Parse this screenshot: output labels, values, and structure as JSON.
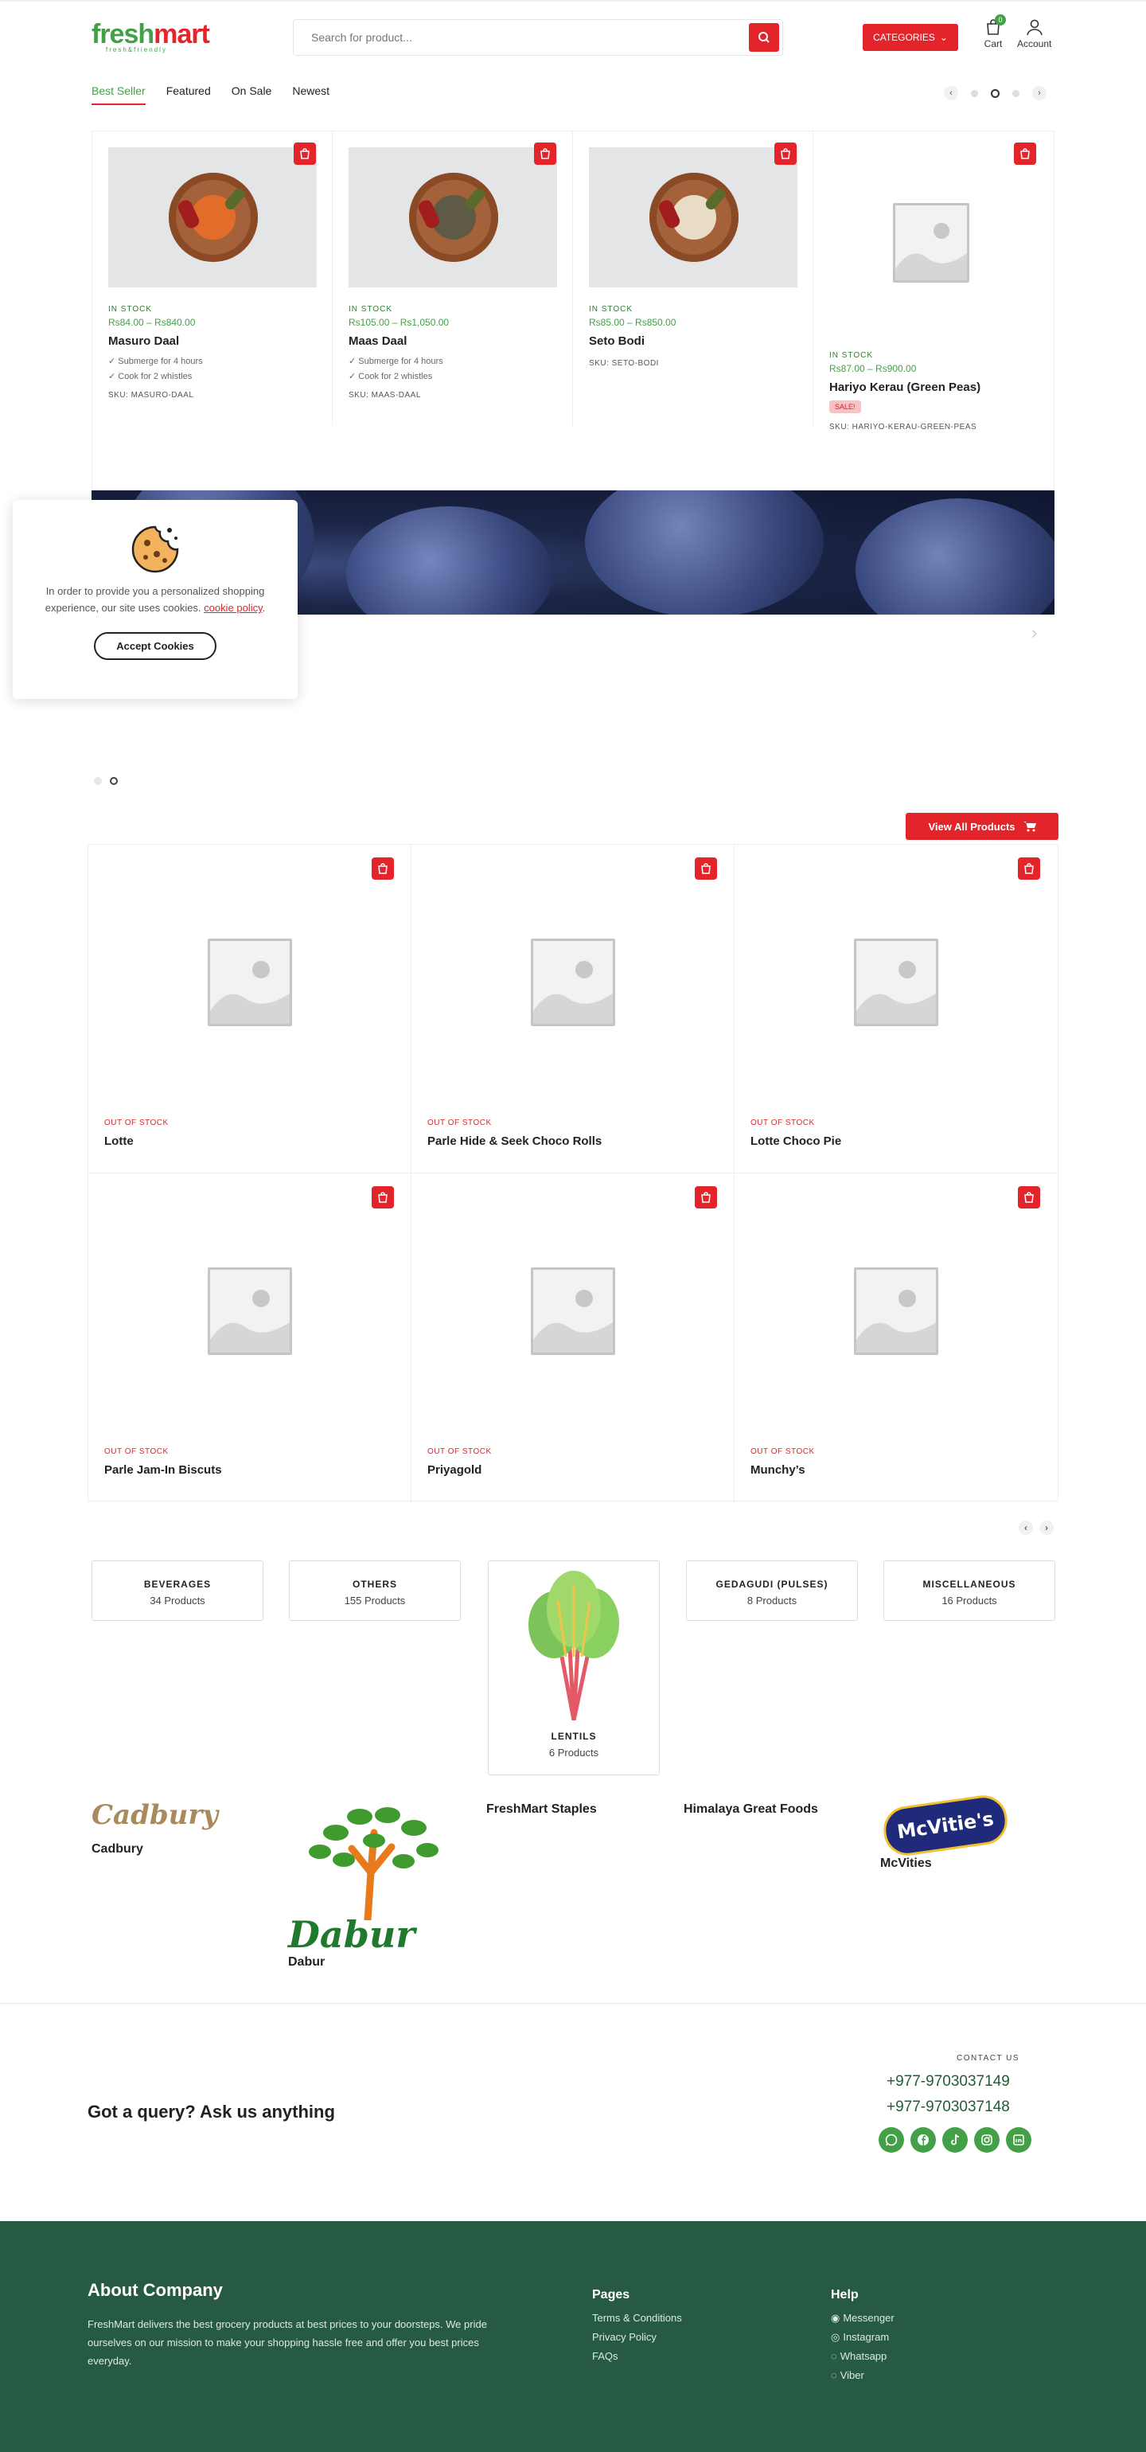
{
  "header": {
    "logo_main_g": "fresh",
    "logo_main_r": "mart",
    "logo_tag": "fresh&friendly",
    "search_placeholder": "Search for product...",
    "categories_label": "CATEGORIES",
    "cart_label": "Cart",
    "cart_count": "0",
    "account_label": "Account"
  },
  "tabs": [
    {
      "label": "Best Seller",
      "active": true
    },
    {
      "label": "Featured"
    },
    {
      "label": "On Sale"
    },
    {
      "label": "Newest"
    }
  ],
  "products": [
    {
      "stock": "IN STOCK",
      "price": "Rs84.00 – Rs840.00",
      "name": "Masuro Daal",
      "features": [
        "✓ Submerge for 4 hours",
        "✓ Cook for 2 whistles"
      ],
      "sku": "SKU: MASURO-DAAL"
    },
    {
      "stock": "IN STOCK",
      "price": "Rs105.00 – Rs1,050.00",
      "name": "Maas Daal",
      "features": [
        "✓ Submerge for 4 hours",
        "✓ Cook for 2 whistles"
      ],
      "sku": "SKU: MAAS-DAAL"
    },
    {
      "stock": "IN STOCK",
      "price": "Rs85.00 – Rs850.00",
      "name": "Seto Bodi",
      "sku": "SKU: SETO-BODI"
    },
    {
      "stock": "IN STOCK",
      "price": "Rs87.00 – Rs900.00",
      "name": "Hariyo Kerau (Green Peas)",
      "sale": "SALE!",
      "sku": "SKU: HARIYO-KERAU-GREEN-PEAS"
    }
  ],
  "cookie": {
    "text": "In order to provide you a personalized shopping experience, our site uses cookies.",
    "link": "cookie policy",
    "accept": "Accept Cookies"
  },
  "view_all": "View All Products",
  "grid_products": [
    {
      "stock": "OUT OF STOCK",
      "name": "Lotte"
    },
    {
      "stock": "OUT OF STOCK",
      "name": "Parle Hide & Seek Choco Rolls"
    },
    {
      "stock": "OUT OF STOCK",
      "name": "Lotte Choco Pie"
    },
    {
      "stock": "OUT OF STOCK",
      "name": "Parle Jam-In Biscuts"
    },
    {
      "stock": "OUT OF STOCK",
      "name": "Priyagold"
    },
    {
      "stock": "OUT OF STOCK",
      "name": "Munchy’s"
    }
  ],
  "categories": [
    {
      "name": "BEVERAGES",
      "count": "34 Products"
    },
    {
      "name": "OTHERS",
      "count": "155 Products"
    },
    {
      "name": "LENTILS",
      "count": "6 Products"
    },
    {
      "name": "GEDAGUDI (PULSES)",
      "count": "8 Products"
    },
    {
      "name": "MISCELLANEOUS",
      "count": "16 Products"
    }
  ],
  "brands": [
    {
      "name": "Cadbury",
      "logo_text": "Cadbury"
    },
    {
      "name": "Dabur",
      "logo_text": "Dabur"
    },
    {
      "name": "FreshMart Staples"
    },
    {
      "name": "Himalaya Great Foods"
    },
    {
      "name": "McVities",
      "logo_text": "McVitie's"
    }
  ],
  "contact": {
    "query_title": "Got a query? Ask us anything",
    "label": "CONTACT US",
    "phones": [
      "+977-9703037149",
      "+977-9703037148"
    ],
    "socials": [
      "whatsapp-icon",
      "facebook-icon",
      "tiktok-icon",
      "instagram-icon",
      "linkedin-icon"
    ]
  },
  "footer": {
    "about_title": "About Company",
    "about_text": "FreshMart delivers the best grocery products at best prices to your doorsteps. We pride ourselves on our mission to make your shopping hassle free and offer you best prices everyday.",
    "pages_title": "Pages",
    "pages": [
      "Terms & Conditions",
      "Privacy Policy",
      "FAQs"
    ],
    "help_title": "Help",
    "help": [
      "Messenger",
      "Instagram",
      "Whatsapp",
      "Viber"
    ]
  },
  "colors": {
    "brand_red": "#e3242b",
    "brand_green": "#43a047",
    "footer_bg": "#265a42"
  }
}
